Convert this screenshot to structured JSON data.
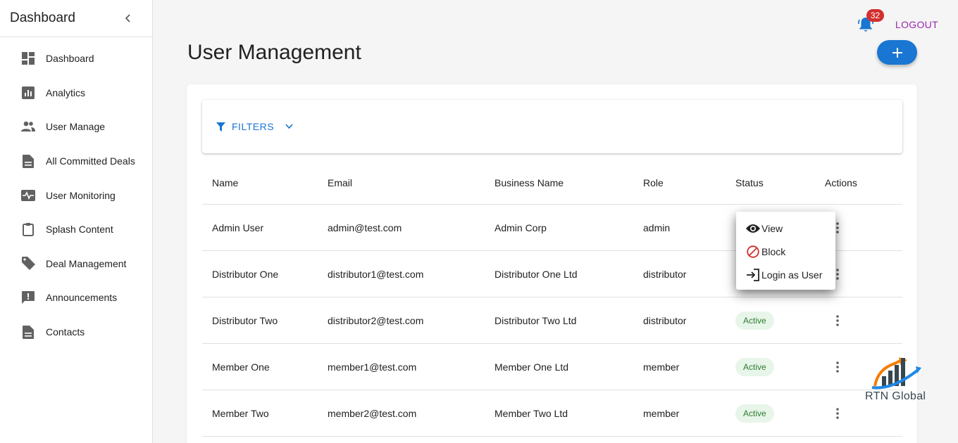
{
  "sidebar": {
    "title": "Dashboard",
    "items": [
      {
        "label": "Dashboard",
        "icon": "dashboard-icon"
      },
      {
        "label": "Analytics",
        "icon": "analytics-icon"
      },
      {
        "label": "User Manage",
        "icon": "people-icon"
      },
      {
        "label": "All Committed Deals",
        "icon": "document-icon"
      },
      {
        "label": "User Monitoring",
        "icon": "monitor-heart-icon"
      },
      {
        "label": "Splash Content",
        "icon": "clipboard-icon"
      },
      {
        "label": "Deal Management",
        "icon": "tag-icon"
      },
      {
        "label": "Announcements",
        "icon": "announcement-icon"
      },
      {
        "label": "Contacts",
        "icon": "document-icon"
      }
    ]
  },
  "header": {
    "notification_count": "32",
    "logout_label": "LOGOUT"
  },
  "page": {
    "title": "User Management",
    "add_label": "+"
  },
  "filters": {
    "label": "FILTERS"
  },
  "table": {
    "columns": [
      "Name",
      "Email",
      "Business Name",
      "Role",
      "Status",
      "Actions"
    ],
    "rows": [
      {
        "name": "Admin User",
        "email": "admin@test.com",
        "business": "Admin Corp",
        "role": "admin",
        "status": ""
      },
      {
        "name": "Distributor One",
        "email": "distributor1@test.com",
        "business": "Distributor One Ltd",
        "role": "distributor",
        "status": ""
      },
      {
        "name": "Distributor Two",
        "email": "distributor2@test.com",
        "business": "Distributor Two Ltd",
        "role": "distributor",
        "status": "Active"
      },
      {
        "name": "Member One",
        "email": "member1@test.com",
        "business": "Member One Ltd",
        "role": "member",
        "status": "Active"
      },
      {
        "name": "Member Two",
        "email": "member2@test.com",
        "business": "Member Two Ltd",
        "role": "member",
        "status": "Active"
      }
    ]
  },
  "menu": {
    "items": [
      {
        "label": "View",
        "icon": "eye-icon"
      },
      {
        "label": "Block",
        "icon": "block-icon"
      },
      {
        "label": "Login as User",
        "icon": "login-icon"
      }
    ]
  },
  "logo": {
    "text": "RTN Global"
  },
  "colors": {
    "primary": "#1976d2",
    "logout": "#9c27b0",
    "badge": "#d32f2f",
    "active_chip_bg": "#e8f5e9",
    "active_chip_text": "#2e7d32"
  }
}
